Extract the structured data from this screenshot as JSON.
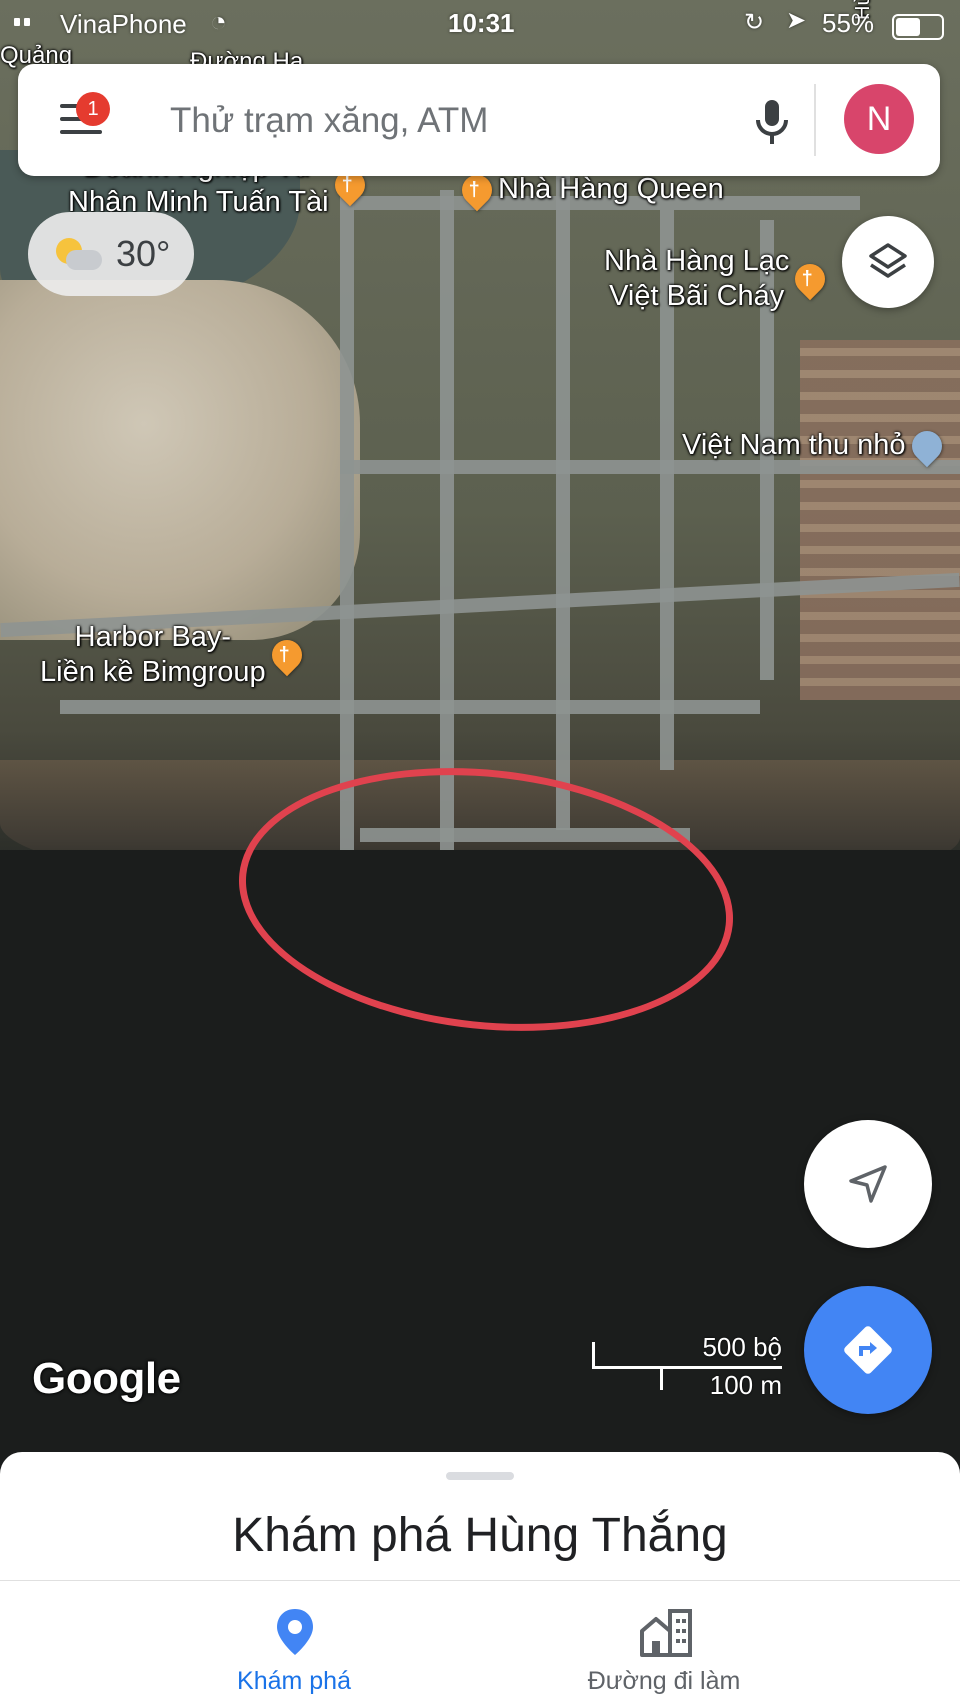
{
  "status_bar": {
    "carrier": "VinaPhone",
    "time": "10:31",
    "battery_percent": "55%",
    "battery_level": 0.55
  },
  "search": {
    "placeholder": "Thử trạm xăng, ATM",
    "notification_count": "1",
    "avatar_letter": "N"
  },
  "weather": {
    "temperature": "30°",
    "icon": "partly-cloudy-icon"
  },
  "map": {
    "places": [
      {
        "name": "Doanh Nghiệp Tư\nNhân Minh Tuấn Tài",
        "icon": "restaurant-icon"
      },
      {
        "name": "Nhà Hàng Queen",
        "icon": "restaurant-icon"
      },
      {
        "name": "Nhà Hàng Lạc\nViệt Bãi Cháy",
        "icon": "restaurant-icon"
      },
      {
        "name": "Việt Nam thu nhỏ",
        "icon": "place-pin-icon"
      },
      {
        "name": "Harbor Bay-\nLiền kề Bimgroup",
        "icon": "restaurant-icon"
      }
    ],
    "street_labels": [
      "Quảng",
      "Đường Hạ",
      "Hùng"
    ],
    "annotation_color": "#e0424e"
  },
  "logo": "Google",
  "scale": {
    "imperial": "500 bộ",
    "metric": "100 m"
  },
  "bottom_sheet": {
    "title": "Khám phá Hùng Thắng"
  },
  "tabs": [
    {
      "label": "Khám phá",
      "icon": "explore-pin-icon",
      "active": true
    },
    {
      "label": "Đường đi làm",
      "icon": "commute-buildings-icon",
      "active": false
    }
  ],
  "colors": {
    "accent_blue": "#4285f4",
    "active_tab": "#1a73e8",
    "badge_red": "#e53b2f",
    "avatar": "#d8456b",
    "poi_orange": "#f59a2f"
  }
}
